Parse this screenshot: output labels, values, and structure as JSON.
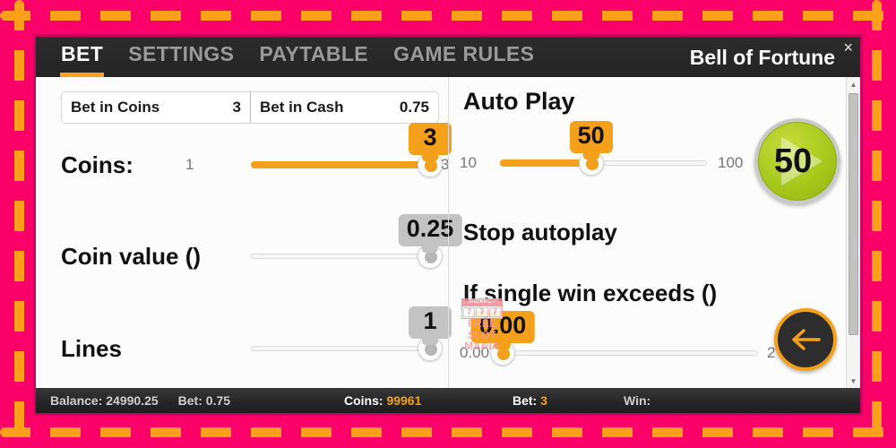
{
  "theme": {
    "frame_pink": "#fa0069",
    "frame_dash_orange": "#fba01a",
    "accent_orange": "#f5a01b",
    "play_green": "#a8c81c",
    "titlebar_dark": "#262626"
  },
  "titlebar": {
    "tabs": [
      {
        "label": "BET",
        "active": true
      },
      {
        "label": "SETTINGS",
        "active": false
      },
      {
        "label": "PAYTABLE",
        "active": false
      },
      {
        "label": "GAME RULES",
        "active": false
      }
    ],
    "game_title": "Bell of Fortune",
    "close_icon": "close-icon",
    "close_glyph": "×"
  },
  "bet_panel": {
    "bet_in_coins": {
      "label": "Bet in Coins",
      "value": "3"
    },
    "bet_in_cash": {
      "label": "Bet in Cash",
      "value": "0.75"
    },
    "sliders": [
      {
        "name": "coins",
        "label": "Coins:",
        "min_label": "1",
        "max_label": "3",
        "value": "3",
        "percent": 100,
        "enabled": true
      },
      {
        "name": "coin-value",
        "label": "Coin value ()",
        "min_label": "",
        "max_label": "",
        "value": "0.25",
        "percent": 100,
        "enabled": false
      },
      {
        "name": "lines",
        "label": "Lines",
        "min_label": "",
        "max_label": "",
        "value": "1",
        "percent": 100,
        "enabled": false
      }
    ]
  },
  "autoplay_panel": {
    "title": "Auto Play",
    "rounds_slider": {
      "min_label": "10",
      "max_label": "100",
      "value": "50",
      "percent": 44,
      "enabled": true
    },
    "play_button": {
      "label": "50",
      "icon": "play-triangle-icon"
    },
    "stop_autoplay_label": "Stop autoplay",
    "single_win_label": "If single win exceeds ()",
    "single_win_slider": {
      "min_label": "0.00",
      "max_label": "2",
      "value": "0.00",
      "percent": 0,
      "enabled": true
    },
    "back_button": {
      "icon": "arrow-left-icon"
    }
  },
  "watermark": {
    "top_text": "JACKPOT",
    "reels": [
      "7",
      "7",
      "7"
    ],
    "line1": "FREE",
    "line2": "SLOT",
    "line3": "MANIA"
  },
  "scrollbar": {
    "up_icon": "chevron-up-icon",
    "down_icon": "chevron-down-icon",
    "up_glyph": "▲",
    "down_glyph": "▼"
  },
  "statusbar": {
    "balance_label": "Balance:",
    "balance_value": "24990.25",
    "bet_cash_label": "Bet:",
    "bet_cash_value": "0.75",
    "coins_label": "Coins:",
    "coins_value": "99961",
    "bet_coins_label": "Bet:",
    "bet_coins_value": "3",
    "win_label": "Win:",
    "win_value": ""
  }
}
